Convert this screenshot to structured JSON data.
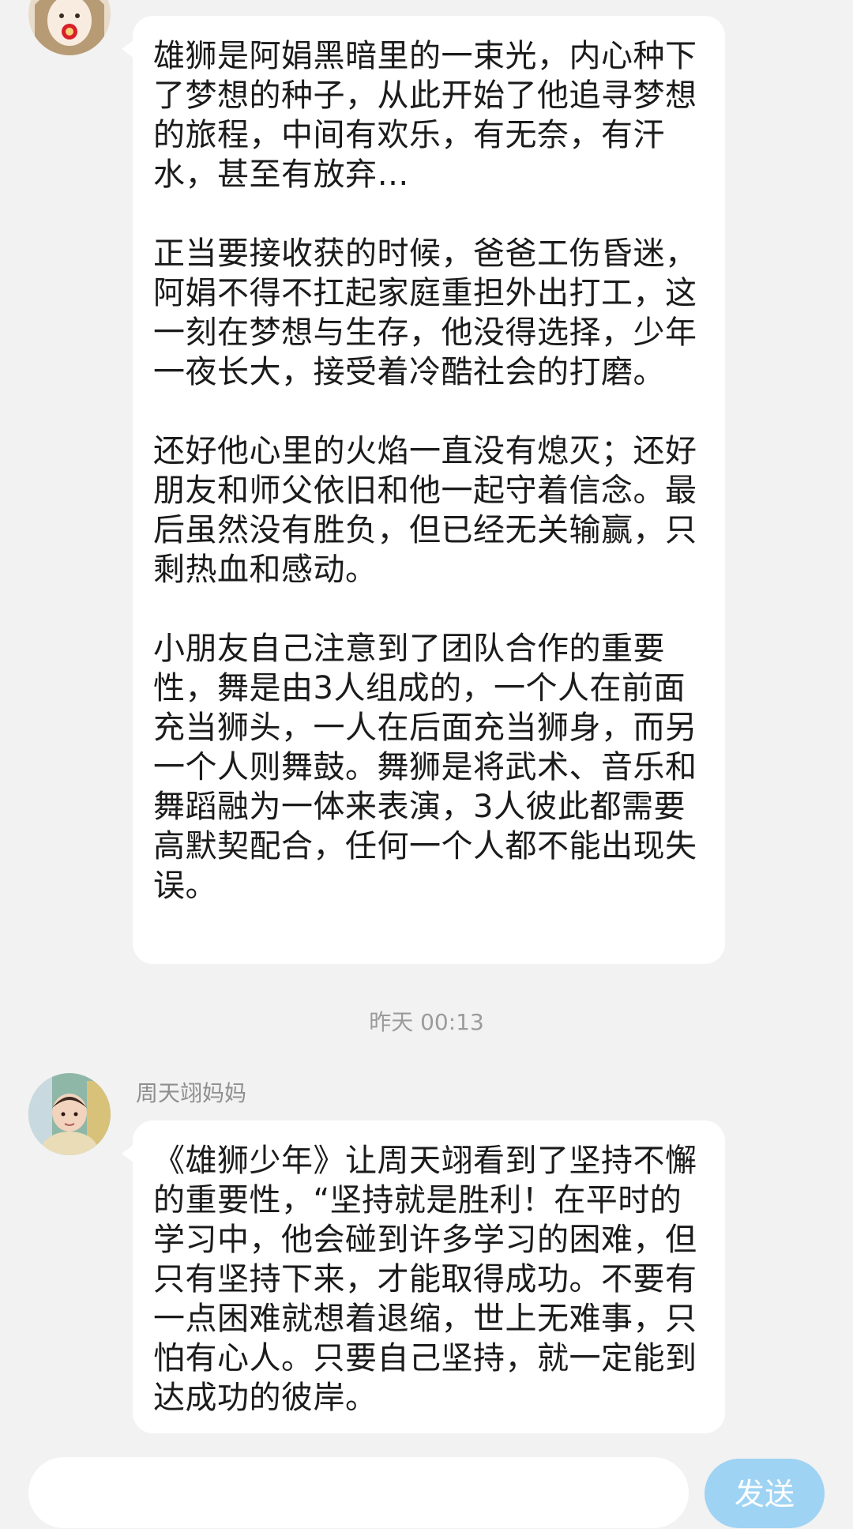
{
  "messages": [
    {
      "paragraphs": [
        "雄狮是阿娟黑暗里的一束光，内心种下了梦想的种子，从此开始了他追寻梦想的旅程，中间有欢乐，有无奈，有汗水，甚至有放弃…",
        "正当要接收获的时候，爸爸工伤昏迷，阿娟不得不扛起家庭重担外出打工，这一刻在梦想与生存，他没得选择，少年一夜长大，接受着冷酷社会的打磨。",
        "还好他心里的火焰一直没有熄灭；还好朋友和师父依旧和他一起守着信念。最后虽然没有胜负，但已经无关输赢，只剩热血和感动。",
        "小朋友自己注意到了团队合作的重要性，舞是由3人组成的，一个人在前面充当狮头，一人在后面充当狮身，而另一个人则舞鼓。舞狮是将武术、音乐和舞蹈融为一体来表演，3人彼此都需要高默契配合，任何一个人都不能出现失误。"
      ]
    },
    {
      "sender": "周天翊妈妈",
      "paragraphs": [
        "《雄狮少年》让周天翊看到了坚持不懈的重要性，“坚持就是胜利！在平时的学习中，他会碰到许多学习的困难，但只有坚持下来，才能取得成功。不要有一点困难就想着退缩，世上无难事，只怕有心人。只要自己坚持，就一定能到达成功的彼岸。"
      ]
    }
  ],
  "timestamp": "昨天 00:13",
  "input": {
    "value": "",
    "placeholder": ""
  },
  "send_label": "发送",
  "colors": {
    "background": "#f2f2f2",
    "bubble": "#ffffff",
    "send_button": "#9fd3f4"
  },
  "icons": [
    "avatar-cartoon-girl-icon",
    "avatar-baby-photo-icon"
  ]
}
